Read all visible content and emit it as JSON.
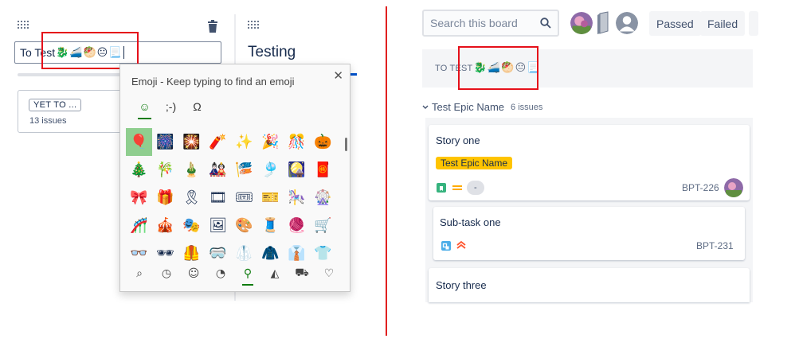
{
  "left_panel": {
    "column_name_input": {
      "text": "To Test",
      "emojis": [
        "🐉",
        "🚄",
        "🥙",
        "😐",
        "📃"
      ]
    },
    "yet_to_column": {
      "label": "YET TO ...",
      "count": "13 issues"
    },
    "testing_column": {
      "title": "Testing"
    }
  },
  "emoji_picker": {
    "title": "Emoji - Keep typing to find an emoji",
    "close_glyph": "✕",
    "tabs": [
      {
        "label": "☺",
        "name": "tab-emoji"
      },
      {
        "label": ";-)",
        "name": "tab-kaomoji"
      },
      {
        "label": "Ω",
        "name": "tab-symbols"
      }
    ],
    "emojis": [
      "🎈",
      "🎆",
      "🎇",
      "🧨",
      "✨",
      "🎉",
      "🎊",
      "🎃",
      "🎄",
      "🎋",
      "🎍",
      "🎎",
      "🎏",
      "🎐",
      "🎑",
      "🧧",
      "🎀",
      "🎁",
      "🎗",
      "🎞",
      "🎟",
      "🎫",
      "🎠",
      "🎡",
      "🎢",
      "🎪",
      "🎭",
      "🖼",
      "🎨",
      "🧵",
      "🧶",
      "🛒",
      "👓",
      "🕶",
      "🦺",
      "🥽",
      "🥼",
      "🧥",
      "👔",
      "👕"
    ],
    "categories": [
      {
        "glyph": "⌕",
        "name": "category-search-icon"
      },
      {
        "glyph": "◷",
        "name": "category-recent-icon"
      },
      {
        "glyph": "☺",
        "name": "category-smiley-icon"
      },
      {
        "glyph": "◔",
        "name": "category-people-icon"
      },
      {
        "glyph": "⚲",
        "name": "category-activities-icon"
      },
      {
        "glyph": "◭",
        "name": "category-food-icon"
      },
      {
        "glyph": "⛟",
        "name": "category-travel-icon"
      },
      {
        "glyph": "♡",
        "name": "category-heart-icon"
      }
    ]
  },
  "right_panel": {
    "search": {
      "placeholder": "Search this board",
      "icon": "search-icon"
    },
    "filters": {
      "passed": "Passed",
      "failed": "Failed"
    },
    "column_header": {
      "text": "TO TEST",
      "emojis": [
        "🐉",
        "🚄",
        "🥙",
        "😐",
        "📃"
      ]
    },
    "epic": {
      "name": "Test Epic Name",
      "count": "6 issues"
    },
    "cards": [
      {
        "title": "Story one",
        "epic_label": "Test Epic Name",
        "estimate": "-",
        "key": "BPT-226"
      },
      {
        "title": "Sub-task one",
        "key": "BPT-231"
      },
      {
        "title": "Story three"
      }
    ]
  },
  "colors": {
    "highlight_red": "#e5101a",
    "epic_yellow": "#ffc400",
    "picker_green": "#107c10",
    "story_green": "#36b37e",
    "subtask_blue": "#4bade8"
  }
}
